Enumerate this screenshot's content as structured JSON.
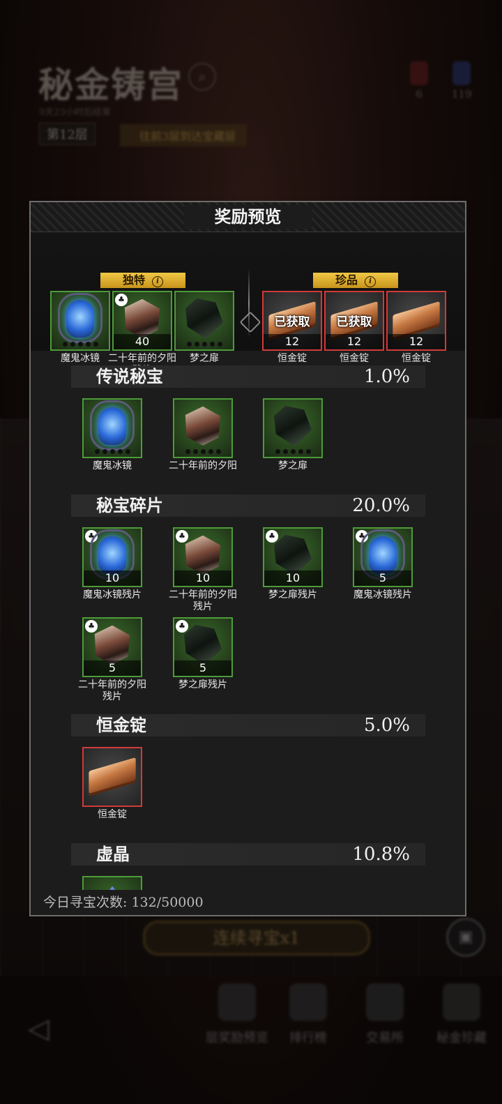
{
  "background": {
    "title": "秘金铸宫",
    "subtitle": "9天23小时后结束",
    "layer": "第12层",
    "hint": "往前3层到达宝藏层",
    "resources": [
      "6",
      "119"
    ],
    "main_button": "连续寻宝x1",
    "nav": [
      "层奖励预览",
      "排行榜",
      "交易所",
      "秘金珍藏"
    ]
  },
  "dialog": {
    "title": "奖励预览",
    "featured": {
      "unique_tag": "独特",
      "rare_tag": "珍品",
      "unique_items": [
        {
          "label": "魔鬼冰镜",
          "count": ""
        },
        {
          "label": "二十年前的夕阳残片",
          "count": "40"
        },
        {
          "label": "梦之扉",
          "count": ""
        }
      ],
      "rare_items": [
        {
          "label": "恒金锭",
          "count": "12",
          "status": "已获取"
        },
        {
          "label": "恒金锭",
          "count": "12",
          "status": "已获取"
        },
        {
          "label": "恒金锭",
          "count": "12",
          "status": ""
        }
      ]
    },
    "sections": [
      {
        "name": "传说秘宝",
        "percent": "1.0%",
        "items": [
          {
            "label": "魔鬼冰镜",
            "count": ""
          },
          {
            "label": "二十年前的夕阳",
            "count": ""
          },
          {
            "label": "梦之扉",
            "count": ""
          }
        ]
      },
      {
        "name": "秘宝碎片",
        "percent": "20.0%",
        "items": [
          {
            "label": "魔鬼冰镜残片",
            "count": "10"
          },
          {
            "label": "二十年前的夕阳残片",
            "count": "10"
          },
          {
            "label": "梦之扉残片",
            "count": "10"
          },
          {
            "label": "魔鬼冰镜残片",
            "count": "5"
          },
          {
            "label": "二十年前的夕阳残片",
            "count": "5"
          },
          {
            "label": "梦之扉残片",
            "count": "5"
          }
        ]
      },
      {
        "name": "恒金锭",
        "percent": "5.0%",
        "items": [
          {
            "label": "恒金锭",
            "count": ""
          }
        ]
      },
      {
        "name": "虚晶",
        "percent": "10.8%",
        "items": []
      }
    ],
    "footer": "今日寻宝次数: 132/50000"
  },
  "colors": {
    "tag_gold": "#e0b030",
    "common_border": "#4e9b3a",
    "rare_border": "#d23a3a"
  }
}
